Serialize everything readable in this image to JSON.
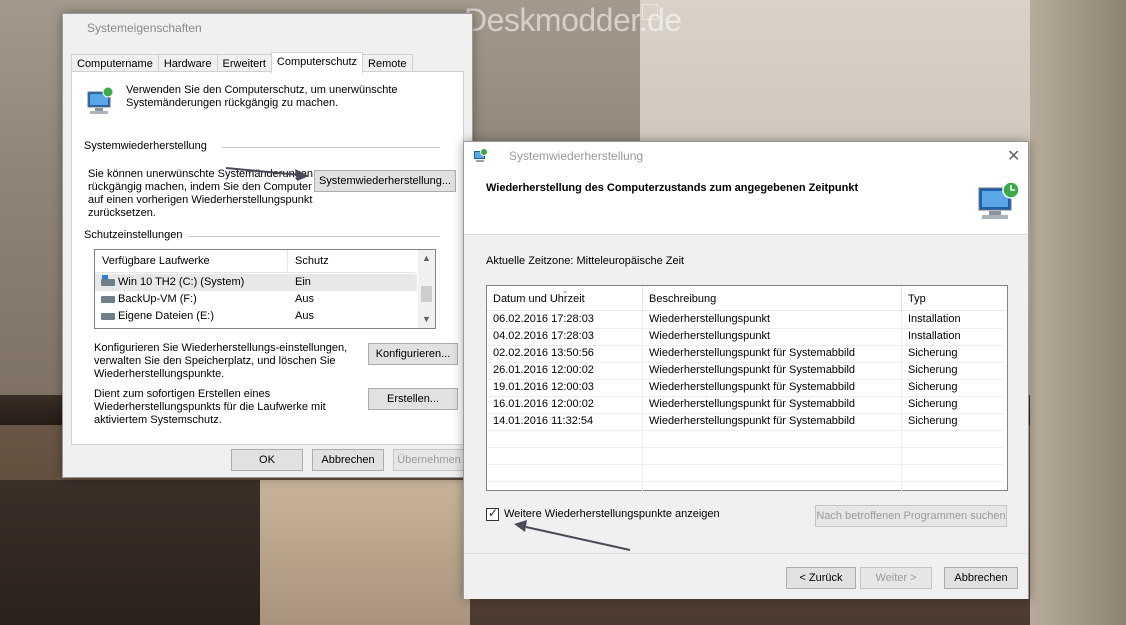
{
  "watermark": "Deskmodder.de",
  "sysprops": {
    "title": "Systemeigenschaften",
    "tabs": [
      "Computername",
      "Hardware",
      "Erweitert",
      "Computerschutz",
      "Remote"
    ],
    "intro": "Verwenden Sie den Computerschutz, um unerwünschte Systemänderungen rückgängig zu machen.",
    "restore_section": "Systemwiederherstellung",
    "restore_text": "Sie können unerwünschte Systemänderungen rückgängig machen, indem Sie den Computer auf einen vorherigen Wiederherstellungspunkt zurücksetzen.",
    "restore_button": "Systemwiederherstellung...",
    "protection_section": "Schutzeinstellungen",
    "drives_headers": [
      "Verfügbare Laufwerke",
      "Schutz"
    ],
    "drives": [
      {
        "name": "Win 10 TH2 (C:) (System)",
        "status": "Ein"
      },
      {
        "name": "BackUp-VM (F:)",
        "status": "Aus"
      },
      {
        "name": "Eigene Dateien (E:)",
        "status": "Aus"
      }
    ],
    "configure_text": "Konfigurieren Sie Wiederherstellungs-einstellungen, verwalten Sie den Speicherplatz, und löschen Sie Wiederherstellungspunkte.",
    "configure_button": "Konfigurieren...",
    "create_text": "Dient zum sofortigen Erstellen eines Wiederherstellungspunkts für die Laufwerke mit aktiviertem Systemschutz.",
    "create_button": "Erstellen...",
    "ok": "OK",
    "cancel": "Abbrechen",
    "apply": "Übernehmen"
  },
  "restore": {
    "title": "Systemwiederherstellung",
    "heading": "Wiederherstellung des Computerzustands zum angegebenen Zeitpunkt",
    "timezone": "Aktuelle Zeitzone: Mitteleuropäische Zeit",
    "headers": [
      "Datum und Uhrzeit",
      "Beschreibung",
      "Typ"
    ],
    "points": [
      {
        "date": "06.02.2016 17:28:03",
        "desc": "Wiederherstellungspunkt",
        "type": "Installation"
      },
      {
        "date": "04.02.2016 17:28:03",
        "desc": "Wiederherstellungspunkt",
        "type": "Installation"
      },
      {
        "date": "02.02.2016 13:50:56",
        "desc": "Wiederherstellungspunkt für Systemabbild",
        "type": "Sicherung"
      },
      {
        "date": "26.01.2016 12:00:02",
        "desc": "Wiederherstellungspunkt für Systemabbild",
        "type": "Sicherung"
      },
      {
        "date": "19.01.2016 12:00:03",
        "desc": "Wiederherstellungspunkt für Systemabbild",
        "type": "Sicherung"
      },
      {
        "date": "16.01.2016 12:00:02",
        "desc": "Wiederherstellungspunkt für Systemabbild",
        "type": "Sicherung"
      },
      {
        "date": "14.01.2016 11:32:54",
        "desc": "Wiederherstellungspunkt für Systemabbild",
        "type": "Sicherung"
      }
    ],
    "show_more": "Weitere Wiederherstellungspunkte anzeigen",
    "show_more_checked": true,
    "scan_button": "Nach betroffenen Programmen suchen",
    "back_button": "< Zurück",
    "next_button": "Weiter >",
    "cancel_button": "Abbrechen"
  }
}
